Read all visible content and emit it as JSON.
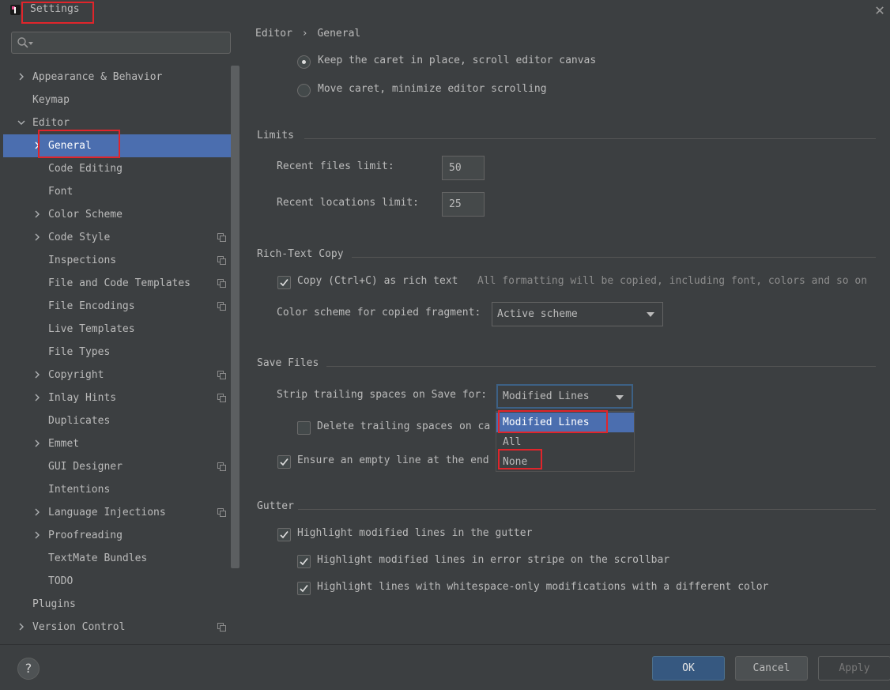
{
  "window": {
    "title": "Settings"
  },
  "sidebar": {
    "search_placeholder": "",
    "items": [
      {
        "label": "Appearance & Behavior",
        "expandable": true,
        "level": 0
      },
      {
        "label": "Keymap",
        "expandable": false,
        "level": 0
      },
      {
        "label": "Editor",
        "expandable": true,
        "expanded": true,
        "level": 0
      },
      {
        "label": "General",
        "expandable": true,
        "level": 1,
        "selected": true
      },
      {
        "label": "Code Editing",
        "expandable": false,
        "level": 1
      },
      {
        "label": "Font",
        "expandable": false,
        "level": 1
      },
      {
        "label": "Color Scheme",
        "expandable": true,
        "level": 1
      },
      {
        "label": "Code Style",
        "expandable": true,
        "level": 1,
        "project": true
      },
      {
        "label": "Inspections",
        "expandable": false,
        "level": 1,
        "project": true
      },
      {
        "label": "File and Code Templates",
        "expandable": false,
        "level": 1,
        "project": true
      },
      {
        "label": "File Encodings",
        "expandable": false,
        "level": 1,
        "project": true
      },
      {
        "label": "Live Templates",
        "expandable": false,
        "level": 1
      },
      {
        "label": "File Types",
        "expandable": false,
        "level": 1
      },
      {
        "label": "Copyright",
        "expandable": true,
        "level": 1,
        "project": true
      },
      {
        "label": "Inlay Hints",
        "expandable": true,
        "level": 1,
        "project": true
      },
      {
        "label": "Duplicates",
        "expandable": false,
        "level": 1
      },
      {
        "label": "Emmet",
        "expandable": true,
        "level": 1
      },
      {
        "label": "GUI Designer",
        "expandable": false,
        "level": 1,
        "project": true
      },
      {
        "label": "Intentions",
        "expandable": false,
        "level": 1
      },
      {
        "label": "Language Injections",
        "expandable": true,
        "level": 1,
        "project": true
      },
      {
        "label": "Proofreading",
        "expandable": true,
        "level": 1
      },
      {
        "label": "TextMate Bundles",
        "expandable": false,
        "level": 1
      },
      {
        "label": "TODO",
        "expandable": false,
        "level": 1
      },
      {
        "label": "Plugins",
        "expandable": false,
        "level": 0
      },
      {
        "label": "Version Control",
        "expandable": true,
        "level": 0,
        "project": true
      }
    ]
  },
  "breadcrumb": {
    "parent": "Editor",
    "separator": "›",
    "current": "General"
  },
  "scrolling": {
    "radio_keep_caret": "Keep the caret in place, scroll editor canvas",
    "radio_move_caret": "Move caret, minimize editor scrolling",
    "selected": "keep_caret"
  },
  "limits": {
    "title": "Limits",
    "recent_files_label": "Recent files limit:",
    "recent_files_value": "50",
    "recent_locations_label": "Recent locations limit:",
    "recent_locations_value": "25"
  },
  "rich_text": {
    "title": "Rich-Text Copy",
    "copy_label": "Copy (Ctrl+C) as rich text",
    "copy_checked": true,
    "copy_hint": "All formatting will be copied, including font, colors and so on",
    "scheme_label": "Color scheme for copied fragment:",
    "scheme_value": "Active scheme"
  },
  "save_files": {
    "title": "Save Files",
    "strip_label": "Strip trailing spaces on Save for:",
    "strip_value": "Modified Lines",
    "strip_options": [
      "Modified Lines",
      "All",
      "None"
    ],
    "delete_label": "Delete trailing spaces on ca",
    "delete_checked": false,
    "ensure_label": "Ensure an empty line at the end",
    "ensure_checked": true
  },
  "gutter": {
    "title": "Gutter",
    "highlight_modified": "Highlight modified lines in the gutter",
    "highlight_error_stripe": "Highlight modified lines in error stripe on the scrollbar",
    "highlight_whitespace": "Highlight lines with whitespace-only modifications with a different color"
  },
  "buttons": {
    "help": "?",
    "ok": "OK",
    "cancel": "Cancel",
    "apply": "Apply"
  },
  "colors": {
    "accent": "#4b6eaf",
    "annotation": "#e0252b",
    "background": "#3c3f41"
  }
}
